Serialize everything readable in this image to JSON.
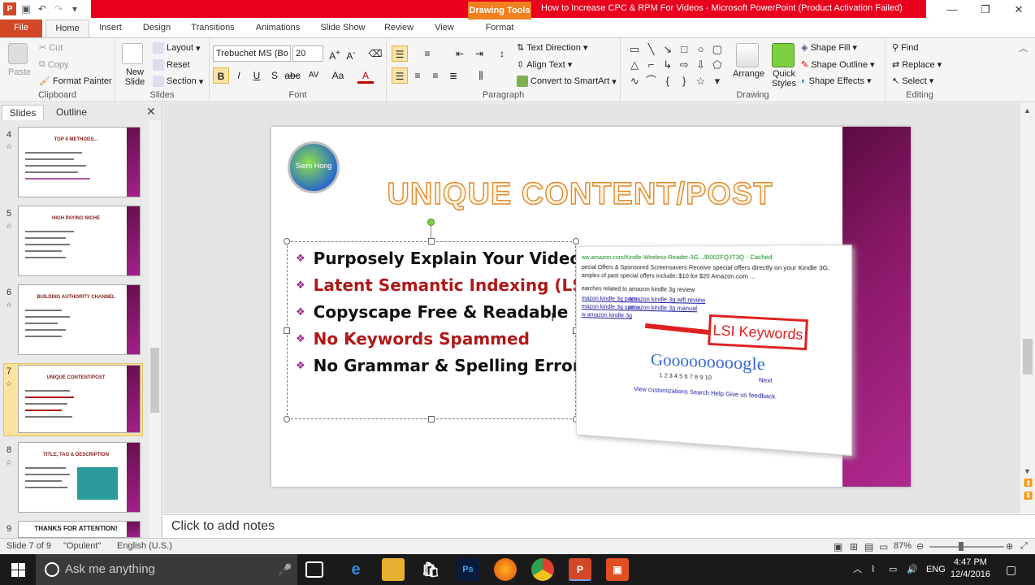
{
  "titlebar": {
    "context_label": "Drawing Tools",
    "doc_title": "How to Increase CPC & RPM For Videos  -  Microsoft PowerPoint (Product Activation Failed)",
    "minimize": "—",
    "restore": "❐",
    "close": "✕"
  },
  "tabs": [
    "File",
    "Home",
    "Insert",
    "Design",
    "Transitions",
    "Animations",
    "Slide Show",
    "Review",
    "View",
    "Format"
  ],
  "ribbon": {
    "clipboard": {
      "label": "Clipboard",
      "paste": "Paste",
      "cut": "Cut",
      "copy": "Copy",
      "format_painter": "Format Painter"
    },
    "slides": {
      "label": "Slides",
      "new_slide": "New Slide",
      "layout": "Layout",
      "reset": "Reset",
      "section": "Section"
    },
    "font": {
      "label": "Font",
      "family": "Trebuchet MS (Bo",
      "size": "20"
    },
    "paragraph": {
      "label": "Paragraph",
      "text_direction": "Text Direction",
      "align_text": "Align Text",
      "convert": "Convert to SmartArt"
    },
    "drawing": {
      "label": "Drawing",
      "arrange": "Arrange",
      "quick_styles": "Quick Styles",
      "shape_fill": "Shape Fill",
      "shape_outline": "Shape Outline",
      "shape_effects": "Shape Effects"
    },
    "editing": {
      "label": "Editing",
      "find": "Find",
      "replace": "Replace",
      "select": "Select"
    }
  },
  "panel": {
    "tab_slides": "Slides",
    "tab_outline": "Outline",
    "thumbs": [
      {
        "num": "4",
        "title": "TOP 4 METHODS..."
      },
      {
        "num": "5",
        "title": "HIGH PAYING NICHE"
      },
      {
        "num": "6",
        "title": "BUILDING AUTHORITY CHANNEL"
      },
      {
        "num": "7",
        "title": "UNIQUE CONTENT/POST"
      },
      {
        "num": "8",
        "title": "TITLE, TAG & DESCRIPTION"
      },
      {
        "num": "9",
        "title": "THANKS FOR ATTENTION!"
      }
    ]
  },
  "slide": {
    "logo_text": "Siem Hong",
    "title": "UNIQUE CONTENT/POST",
    "bullets": [
      {
        "text": "Purposely Explain Your Videos",
        "color": "#111111"
      },
      {
        "text": "Latent Semantic Indexing (LSI)",
        "color": "#b01818"
      },
      {
        "text": "Copyscape Free & Readable",
        "color": "#111111"
      },
      {
        "text": "No Keywords Spammed",
        "color": "#b01818"
      },
      {
        "text": "No Grammar & Spelling Error",
        "color": "#111111"
      }
    ],
    "screenshot": {
      "line1": "ww.amazon.com/Kindle-Wireless-Reader-3G.../B002FQJT3Q - Cached",
      "line2": "pecial Offers & Sponsored Screensavers Receive special offers directly on your Kindle 3G.",
      "line3": "amples of past special offers include: $10 for $20 Amazon.com ...",
      "related": "earches related to amazon kindle 3g review",
      "links": [
        "mazon kindle 3g price",
        "amazon kindle 3g wifi review",
        "mazon kindle 3g specs",
        "amazon kindle 3g manual",
        "w amazon kindle 3g"
      ],
      "google": "Gooooooooogle",
      "pages": "1 2 3 4 5 6 7 8 9 10",
      "next": "Next",
      "footer": "View customizations    Search Help    Give us feedback",
      "callout": "LSI Keywords"
    }
  },
  "notes": {
    "placeholder": "Click to add notes"
  },
  "status": {
    "slide": "Slide 7 of 9",
    "theme": "\"Opulent\"",
    "lang": "English (U.S.)",
    "zoom": "87%"
  },
  "taskbar": {
    "search": "Ask me anything",
    "lang": "ENG",
    "time": "4:47 PM",
    "date": "12/4/2016"
  }
}
